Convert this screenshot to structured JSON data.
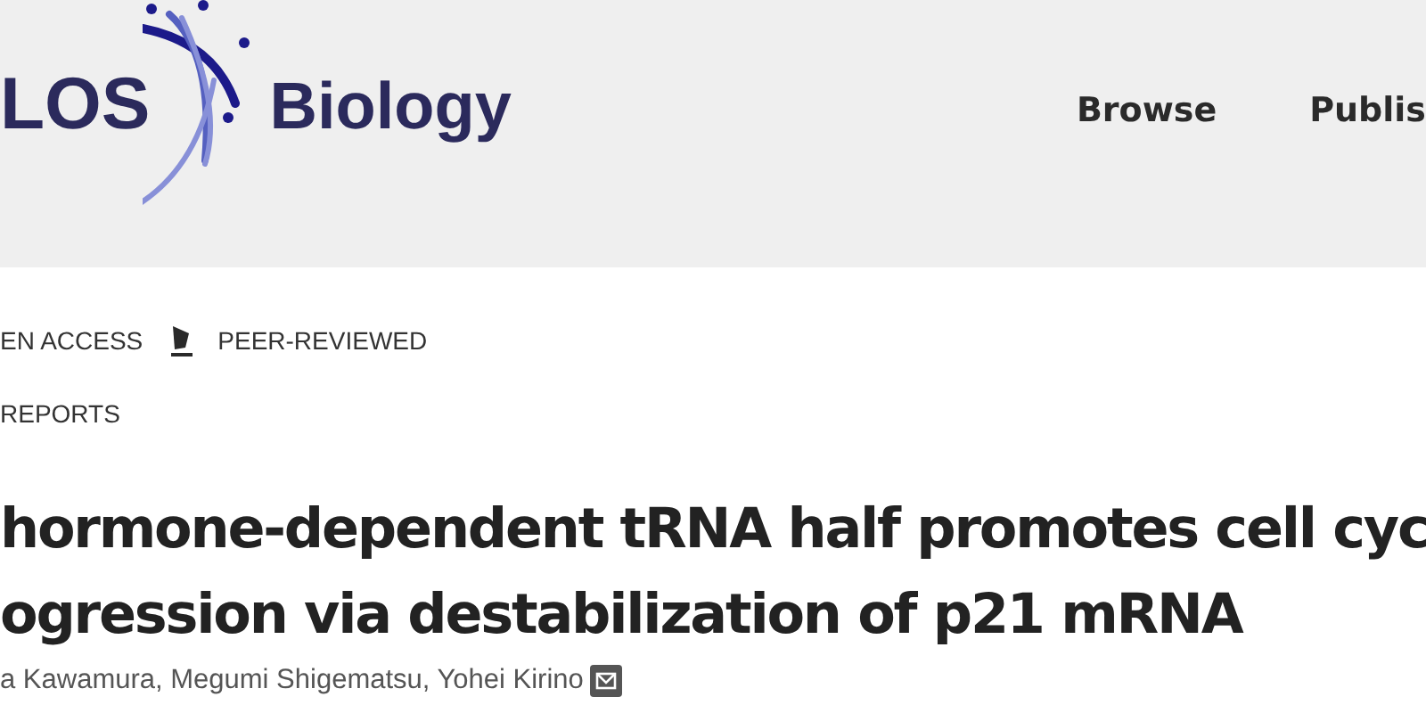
{
  "header": {
    "logo_left": "LOS",
    "logo_right": "Biology",
    "nav": [
      {
        "label": "Browse"
      },
      {
        "label": "Publis"
      }
    ]
  },
  "badges": [
    {
      "kind": "text",
      "label": "EN ACCESS"
    },
    {
      "kind": "icon",
      "label": "PEER-REVIEWED"
    }
  ],
  "article_type": "REPORTS",
  "title_lines": [
    "hormone-dependent tRNA half promotes cell cyc",
    "ogression via destabilization of p21 mRNA"
  ],
  "authors": "a Kawamura, Megumi Shigematsu, Yohei Kirino"
}
